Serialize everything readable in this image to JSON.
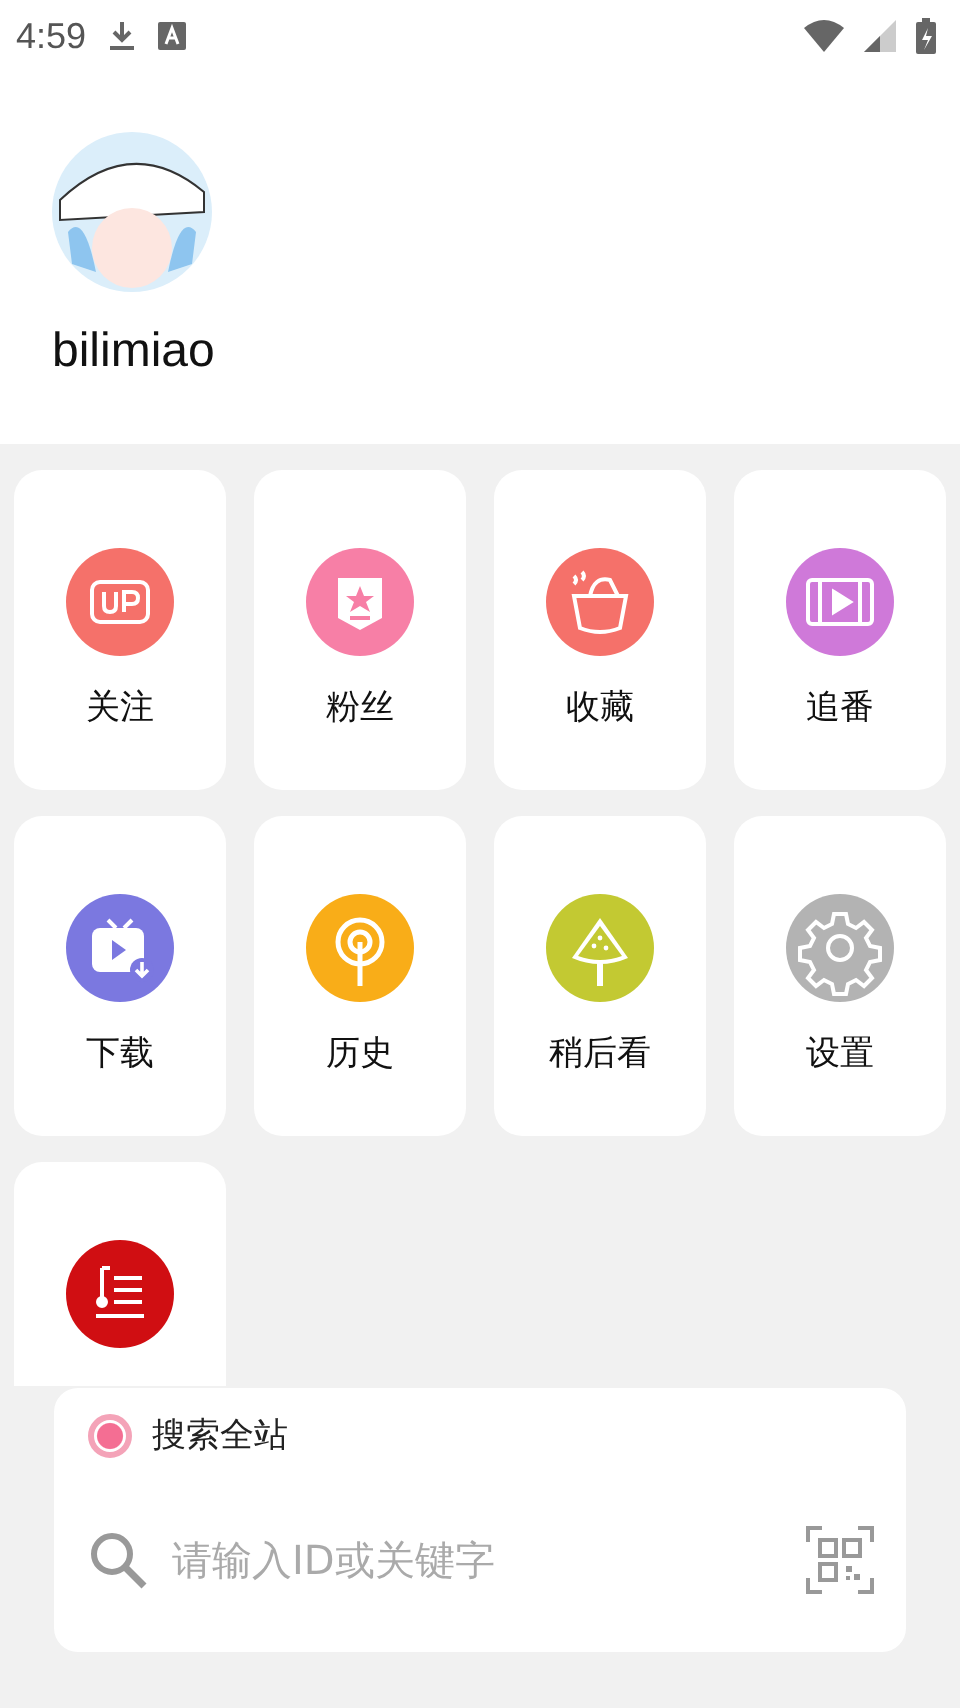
{
  "status_bar": {
    "time": "4:59"
  },
  "profile": {
    "name": "bilimiao"
  },
  "tiles": [
    {
      "label": "关注",
      "kind": "up",
      "color": "#f5716a"
    },
    {
      "label": "粉丝",
      "kind": "badge",
      "color": "#f77fa6"
    },
    {
      "label": "收藏",
      "kind": "pot",
      "color": "#f5716a"
    },
    {
      "label": "追番",
      "kind": "film",
      "color": "#cf79d9"
    },
    {
      "label": "下载",
      "kind": "tv",
      "color": "#7b78e0"
    },
    {
      "label": "历史",
      "kind": "radio",
      "color": "#f9ad18"
    },
    {
      "label": "稍后看",
      "kind": "melon",
      "color": "#c3c932"
    },
    {
      "label": "设置",
      "kind": "gear",
      "color": "#b3b3b3"
    },
    {
      "kind": "lyrics",
      "color": "#d00e12"
    }
  ],
  "search": {
    "scope": {
      "label": "搜索全站",
      "selected": true
    },
    "placeholder": "请输入ID或关键字"
  }
}
